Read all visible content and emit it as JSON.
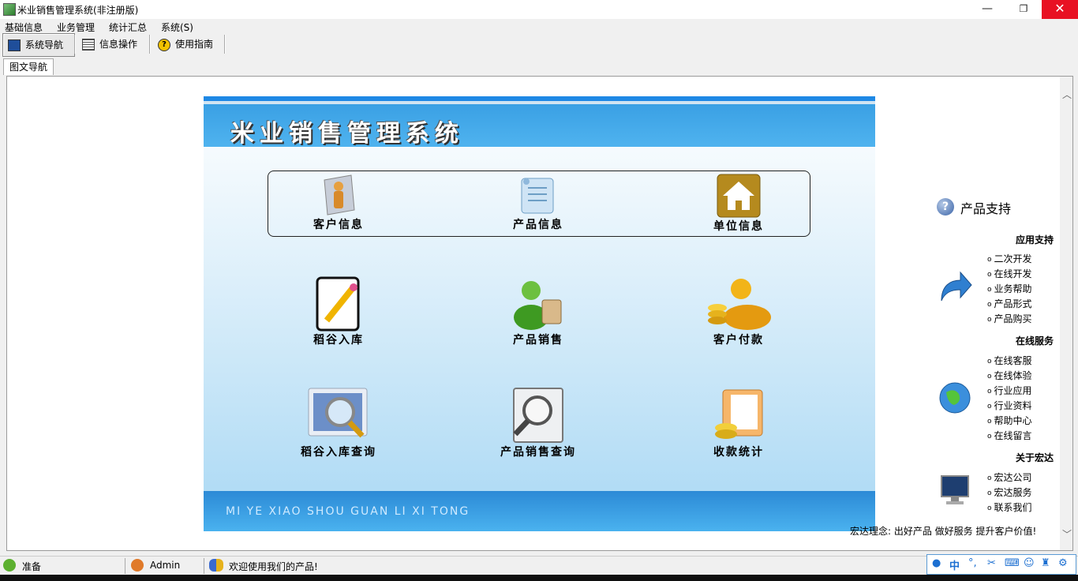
{
  "window": {
    "title": "米业销售管理系统(非注册版)",
    "min": "—",
    "max": "❐",
    "close": "✕"
  },
  "menu": [
    "基础信息",
    "业务管理",
    "统计汇总",
    "系统(S)"
  ],
  "toolbar": {
    "nav": "系统导航",
    "info": "信息操作",
    "guide": "使用指南"
  },
  "tab": {
    "label": "图文导航"
  },
  "panel": {
    "title": "米业销售管理系统",
    "footer": "MI YE XIAO SHOU GUAN LI XI TONG",
    "top_items": [
      "客户信息",
      "产品信息",
      "单位信息"
    ],
    "row2": [
      "稻谷入库",
      "产品销售",
      "客户付款"
    ],
    "row3": [
      "稻谷入库查询",
      "产品销售查询",
      "收款统计"
    ]
  },
  "support": {
    "title": "产品支持",
    "app_support": "应用支持",
    "app_links": [
      "二次开发",
      "在线开发",
      "业务帮助",
      "产品形式",
      "产品购买"
    ],
    "online_service": "在线服务",
    "online_links": [
      "在线客服",
      "在线体验",
      "行业应用",
      "行业资料",
      "帮助中心",
      "在线留言"
    ],
    "about": "关于宏达",
    "about_links": [
      "宏达公司",
      "宏达服务",
      "联系我们"
    ],
    "slogan": "宏达理念: 出好产品 做好服务 提升客户价值!"
  },
  "status": {
    "ready": "准备",
    "user": "Admin",
    "welcome": "欢迎使用我们的产品!"
  },
  "ime": {
    "lang": "中"
  }
}
